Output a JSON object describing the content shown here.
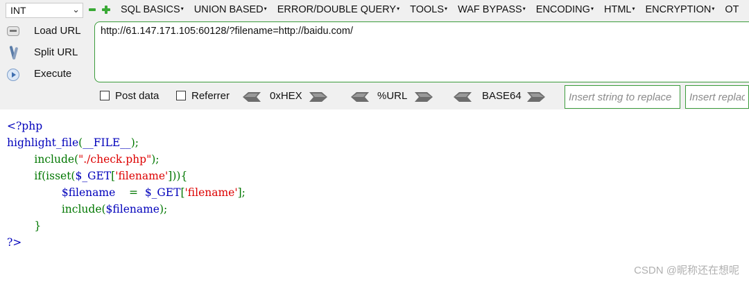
{
  "hackbar": {
    "type_select": "INT",
    "menu": [
      "SQL BASICS",
      "UNION BASED",
      "ERROR/DOUBLE QUERY",
      "TOOLS",
      "WAF BYPASS",
      "ENCODING",
      "HTML",
      "ENCRYPTION",
      "OT"
    ],
    "side_buttons": [
      "Load URL",
      "Split URL",
      "Execute"
    ],
    "url": "http://61.147.171.105:60128/?filename=http://baidu.com/",
    "post_data_label": "Post data",
    "referrer_label": "Referrer",
    "encoders": [
      "0xHEX",
      "%URL",
      "BASE64"
    ],
    "replace_placeholder": "Insert string to replace",
    "replace_with_placeholder": "Insert replacing string",
    "accent_color": "#3a9b3a"
  },
  "code": {
    "lines": [
      "<?php",
      "highlight_file(__FILE__);",
      "include(\"./check.php\");",
      "if(isset($_GET['filename'])){",
      "$filename    =  $_GET['filename'];",
      "include($filename);",
      "}",
      "?>"
    ],
    "colors": {
      "keyword": "#0000bb",
      "default": "#007700",
      "string": "#dd0000"
    }
  },
  "watermark": "CSDN @昵称还在想呢"
}
